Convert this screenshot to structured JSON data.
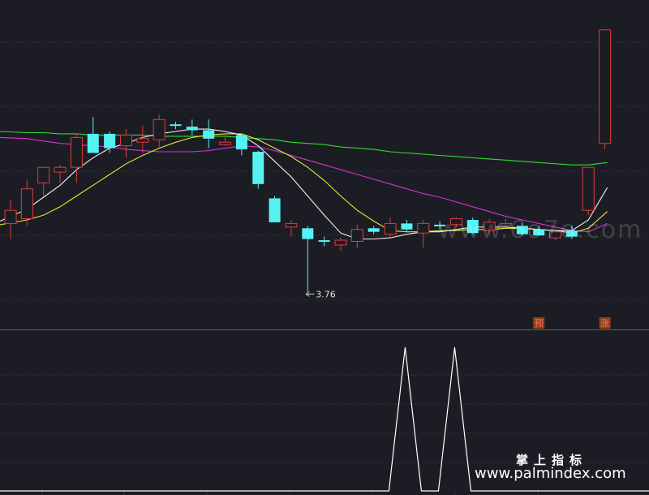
{
  "chart_data": {
    "type": "candlestick",
    "title": "",
    "price_range": [
      3.45,
      6.2
    ],
    "grid": true,
    "colors": {
      "up": "#e03a3a",
      "down": "#55f2f2",
      "ma_short": "#f0f0f0",
      "ma_mid": "#e6e637",
      "ma_long": "#d433d4",
      "ma_longest": "#33d933",
      "signal": "#ffffff",
      "marker_bg": "#8a4412",
      "marker_text": "#ff6a6a"
    },
    "candles": [
      {
        "o": 4.33,
        "h": 4.53,
        "l": 4.2,
        "c": 4.44
      },
      {
        "o": 4.37,
        "h": 4.69,
        "l": 4.31,
        "c": 4.62
      },
      {
        "o": 4.67,
        "h": 4.8,
        "l": 4.56,
        "c": 4.8
      },
      {
        "o": 4.76,
        "h": 4.82,
        "l": 4.67,
        "c": 4.8
      },
      {
        "o": 4.8,
        "h": 5.08,
        "l": 4.67,
        "c": 5.05
      },
      {
        "o": 5.08,
        "h": 5.22,
        "l": 4.96,
        "c": 4.92
      },
      {
        "o": 5.08,
        "h": 5.1,
        "l": 4.92,
        "c": 4.96
      },
      {
        "o": 4.98,
        "h": 5.12,
        "l": 4.88,
        "c": 5.07
      },
      {
        "o": 5.01,
        "h": 5.15,
        "l": 4.92,
        "c": 5.04
      },
      {
        "o": 5.03,
        "h": 5.24,
        "l": 4.97,
        "c": 5.2
      },
      {
        "o": 5.16,
        "h": 5.18,
        "l": 5.12,
        "c": 5.15
      },
      {
        "o": 5.14,
        "h": 5.2,
        "l": 5.07,
        "c": 5.11
      },
      {
        "o": 5.11,
        "h": 5.2,
        "l": 4.96,
        "c": 5.04
      },
      {
        "o": 4.99,
        "h": 5.1,
        "l": 4.98,
        "c": 5.01
      },
      {
        "o": 5.07,
        "h": 5.08,
        "l": 4.9,
        "c": 4.95
      },
      {
        "o": 4.93,
        "h": 4.94,
        "l": 4.62,
        "c": 4.66
      },
      {
        "o": 4.54,
        "h": 4.56,
        "l": 4.34,
        "c": 4.34
      },
      {
        "o": 4.3,
        "h": 4.36,
        "l": 4.22,
        "c": 4.33
      },
      {
        "o": 4.29,
        "h": 4.31,
        "l": 3.76,
        "c": 4.2
      },
      {
        "o": 4.19,
        "h": 4.22,
        "l": 4.14,
        "c": 4.18
      },
      {
        "o": 4.15,
        "h": 4.21,
        "l": 4.1,
        "c": 4.19
      },
      {
        "o": 4.18,
        "h": 4.32,
        "l": 4.12,
        "c": 4.28
      },
      {
        "o": 4.29,
        "h": 4.31,
        "l": 4.24,
        "c": 4.26
      },
      {
        "o": 4.24,
        "h": 4.38,
        "l": 4.21,
        "c": 4.33
      },
      {
        "o": 4.33,
        "h": 4.36,
        "l": 4.26,
        "c": 4.28
      },
      {
        "o": 4.25,
        "h": 4.36,
        "l": 4.13,
        "c": 4.33
      },
      {
        "o": 4.32,
        "h": 4.35,
        "l": 4.28,
        "c": 4.31
      },
      {
        "o": 4.32,
        "h": 4.38,
        "l": 4.3,
        "c": 4.37
      },
      {
        "o": 4.36,
        "h": 4.38,
        "l": 4.24,
        "c": 4.25
      },
      {
        "o": 4.27,
        "h": 4.37,
        "l": 4.24,
        "c": 4.34
      },
      {
        "o": 4.33,
        "h": 4.37,
        "l": 4.31,
        "c": 4.33
      },
      {
        "o": 4.31,
        "h": 4.34,
        "l": 4.23,
        "c": 4.24
      },
      {
        "o": 4.28,
        "h": 4.31,
        "l": 4.23,
        "c": 4.23
      },
      {
        "o": 4.21,
        "h": 4.29,
        "l": 4.19,
        "c": 4.26
      },
      {
        "o": 4.27,
        "h": 4.31,
        "l": 4.2,
        "c": 4.22
      },
      {
        "o": 4.44,
        "h": 4.8,
        "l": 4.4,
        "c": 4.8
      },
      {
        "o": 5.0,
        "h": 5.95,
        "l": 4.95,
        "c": 5.95
      }
    ],
    "ma_short": [
      4.35,
      4.45,
      4.55,
      4.65,
      4.78,
      4.88,
      4.96,
      5.0,
      5.05,
      5.08,
      5.1,
      5.12,
      5.12,
      5.1,
      5.07,
      4.98,
      4.85,
      4.72,
      4.56,
      4.4,
      4.25,
      4.2,
      4.2,
      4.21,
      4.24,
      4.26,
      4.26,
      4.28,
      4.3,
      4.3,
      4.3,
      4.29,
      4.28,
      4.27,
      4.27,
      4.36,
      4.63
    ],
    "ma_mid": [
      4.32,
      4.36,
      4.4,
      4.47,
      4.56,
      4.65,
      4.74,
      4.83,
      4.9,
      4.96,
      5.01,
      5.05,
      5.07,
      5.08,
      5.08,
      5.03,
      4.96,
      4.89,
      4.8,
      4.69,
      4.56,
      4.44,
      4.35,
      4.27,
      4.26,
      4.26,
      4.27,
      4.27,
      4.28,
      4.28,
      4.29,
      4.29,
      4.28,
      4.27,
      4.25,
      4.29,
      4.43
    ],
    "ma_long": [
      5.05,
      5.04,
      5.02,
      5.0,
      4.99,
      4.98,
      4.97,
      4.95,
      4.94,
      4.93,
      4.93,
      4.93,
      4.94,
      4.96,
      4.98,
      4.97,
      4.94,
      4.9,
      4.86,
      4.82,
      4.78,
      4.74,
      4.7,
      4.66,
      4.62,
      4.58,
      4.55,
      4.51,
      4.47,
      4.43,
      4.39,
      4.36,
      4.33,
      4.3,
      4.27,
      4.26,
      4.33
    ],
    "ma_longest": [
      5.1,
      5.09,
      5.09,
      5.08,
      5.08,
      5.07,
      5.07,
      5.07,
      5.07,
      5.06,
      5.06,
      5.06,
      5.06,
      5.06,
      5.05,
      5.04,
      5.03,
      5.01,
      5.0,
      4.99,
      4.97,
      4.96,
      4.95,
      4.93,
      4.92,
      4.91,
      4.9,
      4.89,
      4.88,
      4.87,
      4.86,
      4.85,
      4.84,
      4.83,
      4.82,
      4.82,
      4.84
    ],
    "low_annotation": {
      "index": 18,
      "value": 3.76,
      "label": "3.76"
    },
    "markers": [
      {
        "index": 32,
        "label": "预"
      },
      {
        "index": 36,
        "label": "涨"
      }
    ],
    "signal": {
      "range": [
        0,
        1
      ],
      "peaks": [
        {
          "index": 24,
          "value": 1
        },
        {
          "index": 27,
          "value": 1
        }
      ]
    }
  },
  "watermarks": {
    "top": "www.6o7o.com",
    "cn": "掌上指标",
    "url": "www.palmindex.com"
  }
}
